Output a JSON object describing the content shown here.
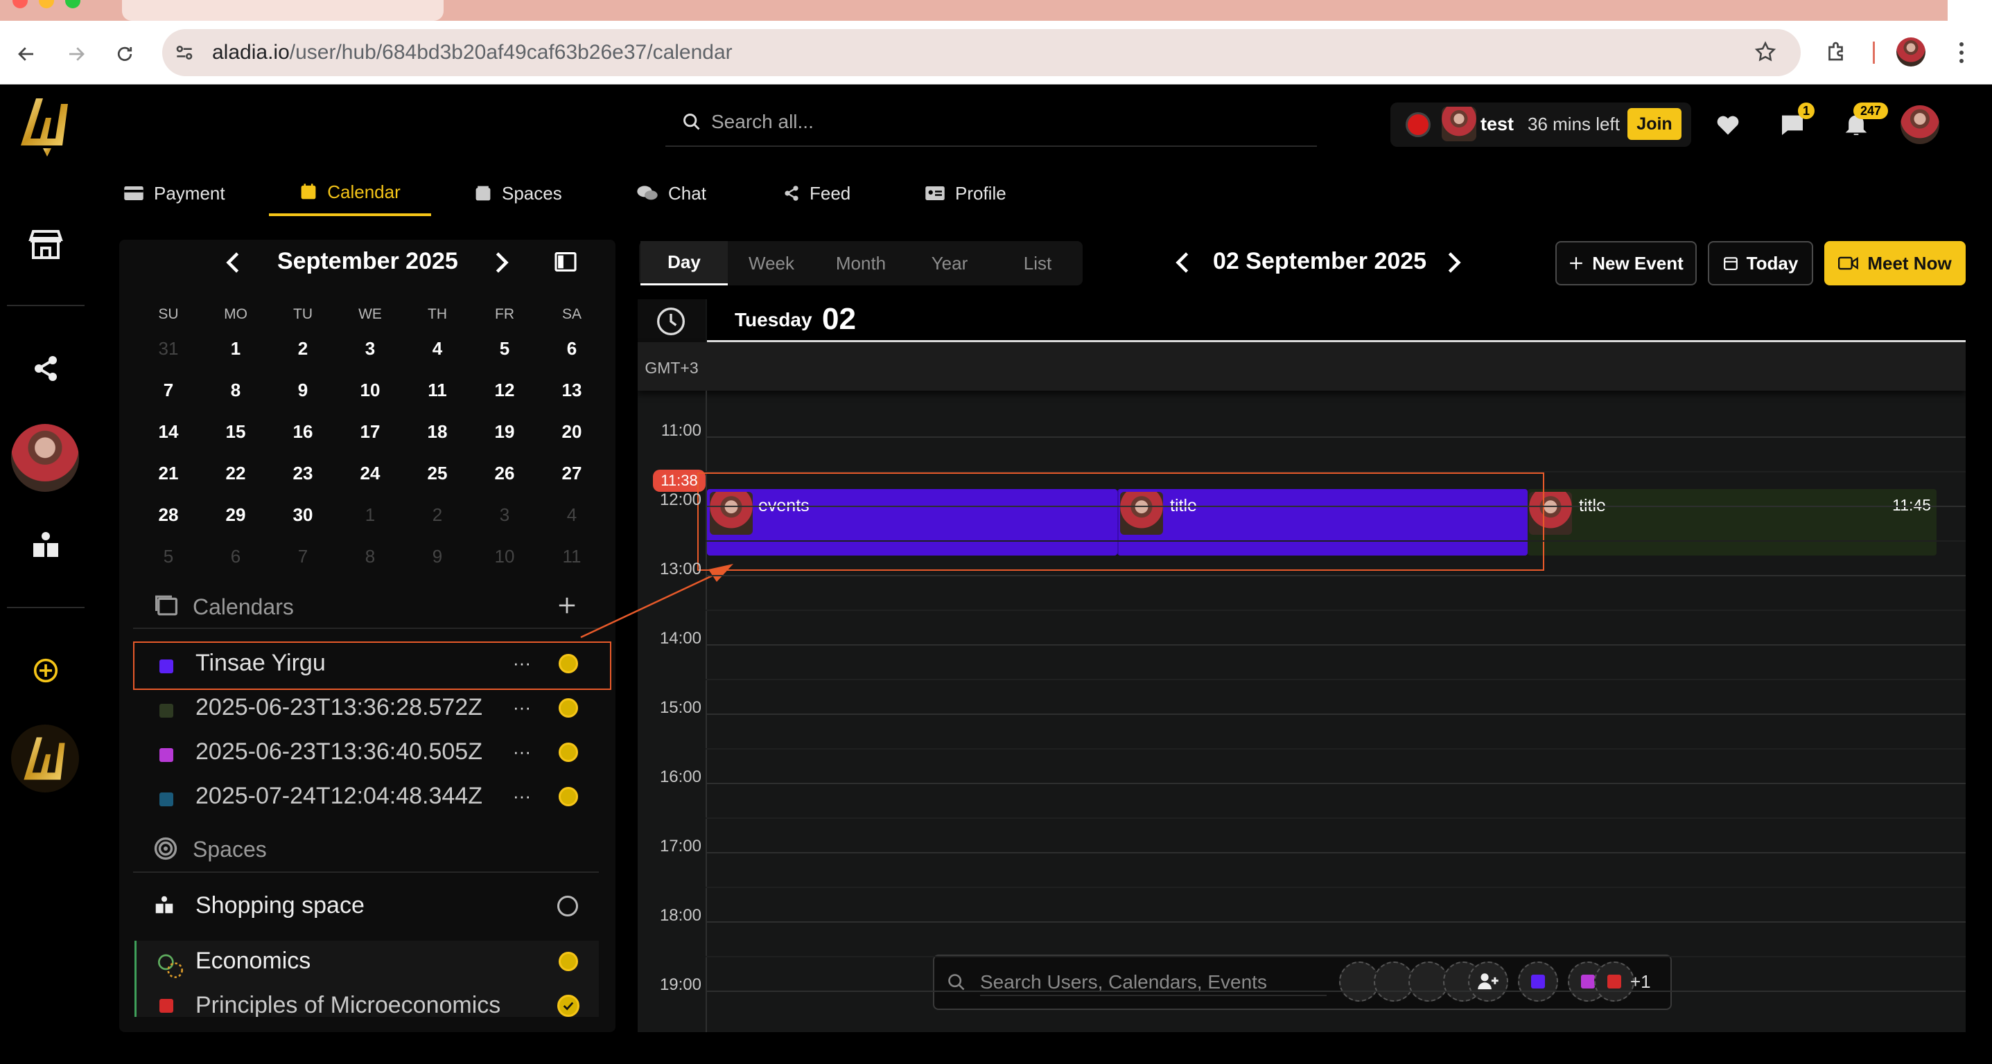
{
  "browser": {
    "url_domain": "aladia.io",
    "url_path": "/user/hub/684bd3b20af49caf63b26e37/calendar"
  },
  "header": {
    "search_placeholder": "Search all...",
    "meeting": {
      "name": "test",
      "time_left": "36 mins left",
      "join_label": "Join"
    },
    "chat_badge": "1",
    "notification_badge": "247"
  },
  "nav_tabs": [
    {
      "label": "Payment",
      "icon": "credit-card-icon"
    },
    {
      "label": "Calendar",
      "icon": "calendar-icon"
    },
    {
      "label": "Spaces",
      "icon": "spaces-icon"
    },
    {
      "label": "Chat",
      "icon": "chat-icon"
    },
    {
      "label": "Feed",
      "icon": "share-icon"
    },
    {
      "label": "Profile",
      "icon": "id-card-icon"
    }
  ],
  "mini_calendar": {
    "month_label": "September 2025",
    "weekdays": [
      "SU",
      "MO",
      "TU",
      "WE",
      "TH",
      "FR",
      "SA"
    ],
    "weeks": [
      [
        "31",
        "1",
        "2",
        "3",
        "4",
        "5",
        "6"
      ],
      [
        "7",
        "8",
        "9",
        "10",
        "11",
        "12",
        "13"
      ],
      [
        "14",
        "15",
        "16",
        "17",
        "18",
        "19",
        "20"
      ],
      [
        "21",
        "22",
        "23",
        "24",
        "25",
        "26",
        "27"
      ],
      [
        "28",
        "29",
        "30",
        "1",
        "2",
        "3",
        "4"
      ],
      [
        "5",
        "6",
        "7",
        "8",
        "9",
        "10",
        "11"
      ]
    ]
  },
  "calendars": {
    "title": "Calendars",
    "items": [
      {
        "name": "Tinsae Yirgu",
        "color": "#5b21f5"
      },
      {
        "name": "2025-06-23T13:36:28.572Z",
        "color": "#2e3a22"
      },
      {
        "name": "2025-06-23T13:36:40.505Z",
        "color": "#b83ad6"
      },
      {
        "name": "2025-07-24T12:04:48.344Z",
        "color": "#1a5a7a"
      }
    ]
  },
  "spaces": {
    "title": "Spaces",
    "items": [
      {
        "name": "Shopping space"
      },
      {
        "name": "Economics"
      },
      {
        "name": "Principles of Microeconomics"
      }
    ]
  },
  "view": {
    "tabs": [
      "Day",
      "Week",
      "Month",
      "Year",
      "List"
    ],
    "date_title": "02 September 2025",
    "new_event_label": "New Event",
    "today_label": "Today",
    "meet_now_label": "Meet Now"
  },
  "day_view": {
    "weekday": "Tuesday",
    "day_number": "02",
    "timezone": "GMT+3",
    "hours": [
      "11:00",
      "12:00",
      "13:00",
      "14:00",
      "15:00",
      "16:00",
      "17:00",
      "18:00",
      "19:00"
    ],
    "now_label": "11:38",
    "events": [
      {
        "title": "events",
        "color": "#4a0fd6"
      },
      {
        "title": "title",
        "color": "#4a0fd6"
      },
      {
        "title": "title",
        "color": "#1e2a16",
        "time": "11:45"
      }
    ]
  },
  "bottom_search": {
    "placeholder": "Search Users, Calendars, Events",
    "more_count": "+1"
  }
}
